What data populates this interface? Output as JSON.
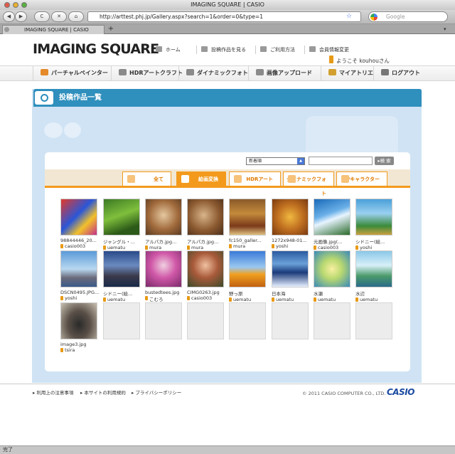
{
  "window": {
    "title": "IMAGING SQUARE | CASIO"
  },
  "browser": {
    "back": "◀",
    "forward": "▶",
    "reload": "C",
    "stop": "✕",
    "home": "⌂",
    "url": "http://arttest.phj.jp/Gallery.aspx?search=1&order=0&type=1",
    "search_placeholder": "Google",
    "tab_label": "IMAGING SQUARE | CASIO",
    "newtab": "+",
    "status": "完了"
  },
  "site": {
    "logo": "IMAGING SQUARE",
    "topnav": [
      {
        "label": "ホーム"
      },
      {
        "label": "投稿作品を見る"
      },
      {
        "label": "ご利用方法"
      },
      {
        "label": "会員情報変更"
      }
    ],
    "welcome": "ようこそ kouhouさん",
    "menu": [
      {
        "label": "パーチャルペインター",
        "color": "#e58a2a"
      },
      {
        "label": "HDRアートクラフト",
        "color": "#8a8a8a"
      },
      {
        "label": "ダイナミックフォト",
        "color": "#8a8a8a"
      },
      {
        "label": "画像アップロード",
        "color": "#8a8a8a"
      },
      {
        "label": "マイアトリエ",
        "color": "#d2a030"
      },
      {
        "label": "ログアウト",
        "color": "#777"
      }
    ]
  },
  "gallery": {
    "section_title": "投稿作品一覧",
    "sort_selected": "新着順",
    "search_button": "▸検 索",
    "filters": [
      {
        "label": "全て",
        "active": false
      },
      {
        "label": "絵画変換",
        "active": true
      },
      {
        "label": "HDRアート",
        "active": false
      },
      {
        "label": "ダイナミックフォト",
        "active": false
      },
      {
        "label": "DPキャラクター",
        "active": false
      }
    ],
    "items": [
      {
        "name": "98844446_20...",
        "user": "casio003",
        "bg": "linear-gradient(135deg,#e23a2a,#2a56d8 45%,#f2c12a 70%,#c32f8a)"
      },
      {
        "name": "ジャングル・...",
        "user": "uematu",
        "bg": "linear-gradient(160deg,#3c7a24,#7fbf3c 45%,#2c5a18 80%)"
      },
      {
        "name": "アルパカ.jpg...",
        "user": "mura",
        "bg": "radial-gradient(circle at 50% 45%,#e5c8a0,#a06a3c 55%,#5a3a20)"
      },
      {
        "name": "アルパカ.jpg...",
        "user": "mura",
        "bg": "radial-gradient(circle at 45% 45%,#d8b48a,#8c5a30 55%,#4a2e1a)"
      },
      {
        "name": "fc150_galler...",
        "user": "mura",
        "bg": "linear-gradient(180deg,#8a5a2a,#c48a3a 40%,#7a3a1a 75%,#e0c080)"
      },
      {
        "name": "1272x948-01...",
        "user": "yoshi",
        "bg": "radial-gradient(circle at 50% 50%,#f0b840,#c07020 50%,#7a3a10)"
      },
      {
        "name": "元画像.jpg(...",
        "user": "casio003",
        "bg": "linear-gradient(160deg,#1a6ab8,#6ab0e8 40%,#e8f4ff 55%,#2a6a2a)"
      },
      {
        "name": "シドニー(絵...",
        "user": "yoshi",
        "bg": "linear-gradient(180deg,#4aa0d8,#9ad0f0 40%,#3a8a3a 75%,#caa040)"
      },
      {
        "name": "DSCN0495.JPG...",
        "user": "yoshi",
        "bg": "linear-gradient(180deg,#5a9ad8,#b8d8f0 50%,#6a6a7a 75%,#3a5a8a)"
      },
      {
        "name": "シドニー(絵...",
        "user": "uematu",
        "bg": "linear-gradient(180deg,#2a4a8a,#6a8ac0 40%,#3a3a4a 70%,#1a2a4a)"
      },
      {
        "name": "bustedtees.jpg",
        "user": "こむろ",
        "bg": "radial-gradient(circle at 50% 40%,#f0d0e0,#d058a8 45%,#7a2a6a)"
      },
      {
        "name": "CIMG0263.jpg",
        "user": "casio003",
        "bg": "radial-gradient(circle at 50% 40%,#f0c0a0,#a85a3a 45%,#3a4a2a)"
      },
      {
        "name": "野っ原",
        "user": "uematu",
        "bg": "linear-gradient(180deg,#3a7ad8,#9ac8f0 45%,#f0a020 65%,#c06010)"
      },
      {
        "name": "日本海",
        "user": "uematu",
        "bg": "linear-gradient(180deg,#2a5aa0,#6aa0d8 35%,#1a3a7a 60%,#e8f0ff)"
      },
      {
        "name": "水瀬",
        "user": "uematu",
        "bg": "radial-gradient(circle at 50% 50%,#f8f0a0,#b8d870 40%,#3a8ab8)"
      },
      {
        "name": "水辺",
        "user": "uematu",
        "bg": "linear-gradient(180deg,#8ac8e8,#d8f0f8 40%,#4a9a6a 70%,#2a6a8a)"
      },
      {
        "name": "image3.jpg",
        "user": "tsira",
        "bg": "radial-gradient(ellipse at 50% 60%,#2a2a2a,#5a5048 45%,#c8c0b0)"
      }
    ],
    "empty_slots": 7
  },
  "footer": {
    "links": [
      {
        "label": "利用上の注意事項"
      },
      {
        "label": "本サイトの利用規約"
      },
      {
        "label": "プライバシーポリシー"
      }
    ],
    "copyright": "© 2011 CASIO COMPUTER CO., LTD.",
    "brand": "CASIO"
  }
}
